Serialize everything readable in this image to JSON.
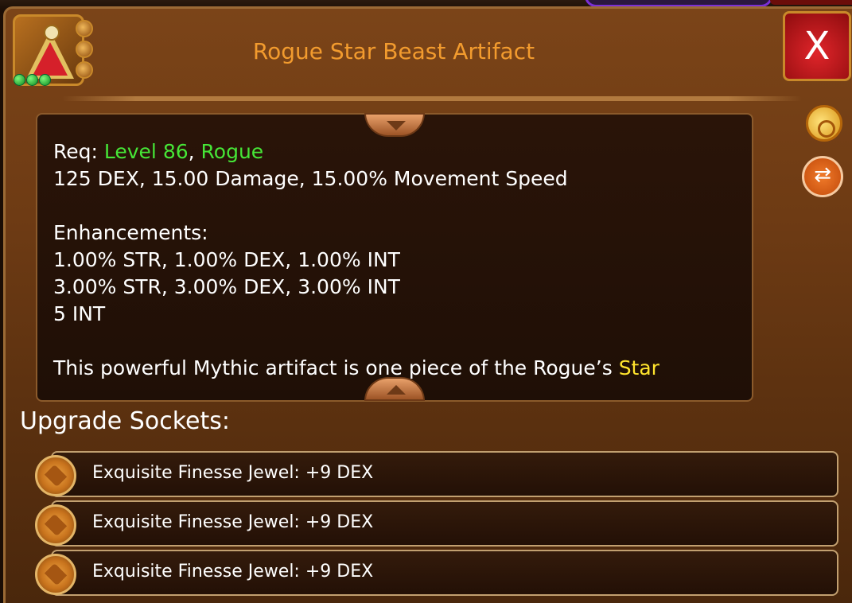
{
  "item": {
    "title": "Rogue Star Beast Artifact",
    "close_label": "X",
    "icon": "artifact-pyramid-icon"
  },
  "description": {
    "req_prefix": "Req: ",
    "req_level": "Level 86",
    "req_sep": ", ",
    "req_class": "Rogue",
    "stats": "125 DEX, 15.00 Damage, 15.00% Movement Speed",
    "enh_heading": "Enhancements:",
    "enh_1": "1.00% STR, 1.00% DEX, 1.00% INT",
    "enh_2": "3.00% STR, 3.00% DEX, 3.00% INT",
    "enh_3": "5 INT",
    "lore_prefix": "This powerful Mythic artifact is one piece of the Rogue’s ",
    "lore_highlight": "Star"
  },
  "sockets": {
    "heading": "Upgrade Sockets:",
    "items": [
      {
        "label": "Exquisite Finesse Jewel: +9 DEX"
      },
      {
        "label": "Exquisite Finesse Jewel: +9 DEX"
      },
      {
        "label": "Exquisite Finesse Jewel: +9 DEX"
      }
    ]
  },
  "side_icons": [
    "money-bag-icon",
    "swap-icon"
  ],
  "colors": {
    "title": "#f29b2e",
    "requirement": "#46e637",
    "highlight": "#ffe42d",
    "close_button": "#d5202a"
  }
}
